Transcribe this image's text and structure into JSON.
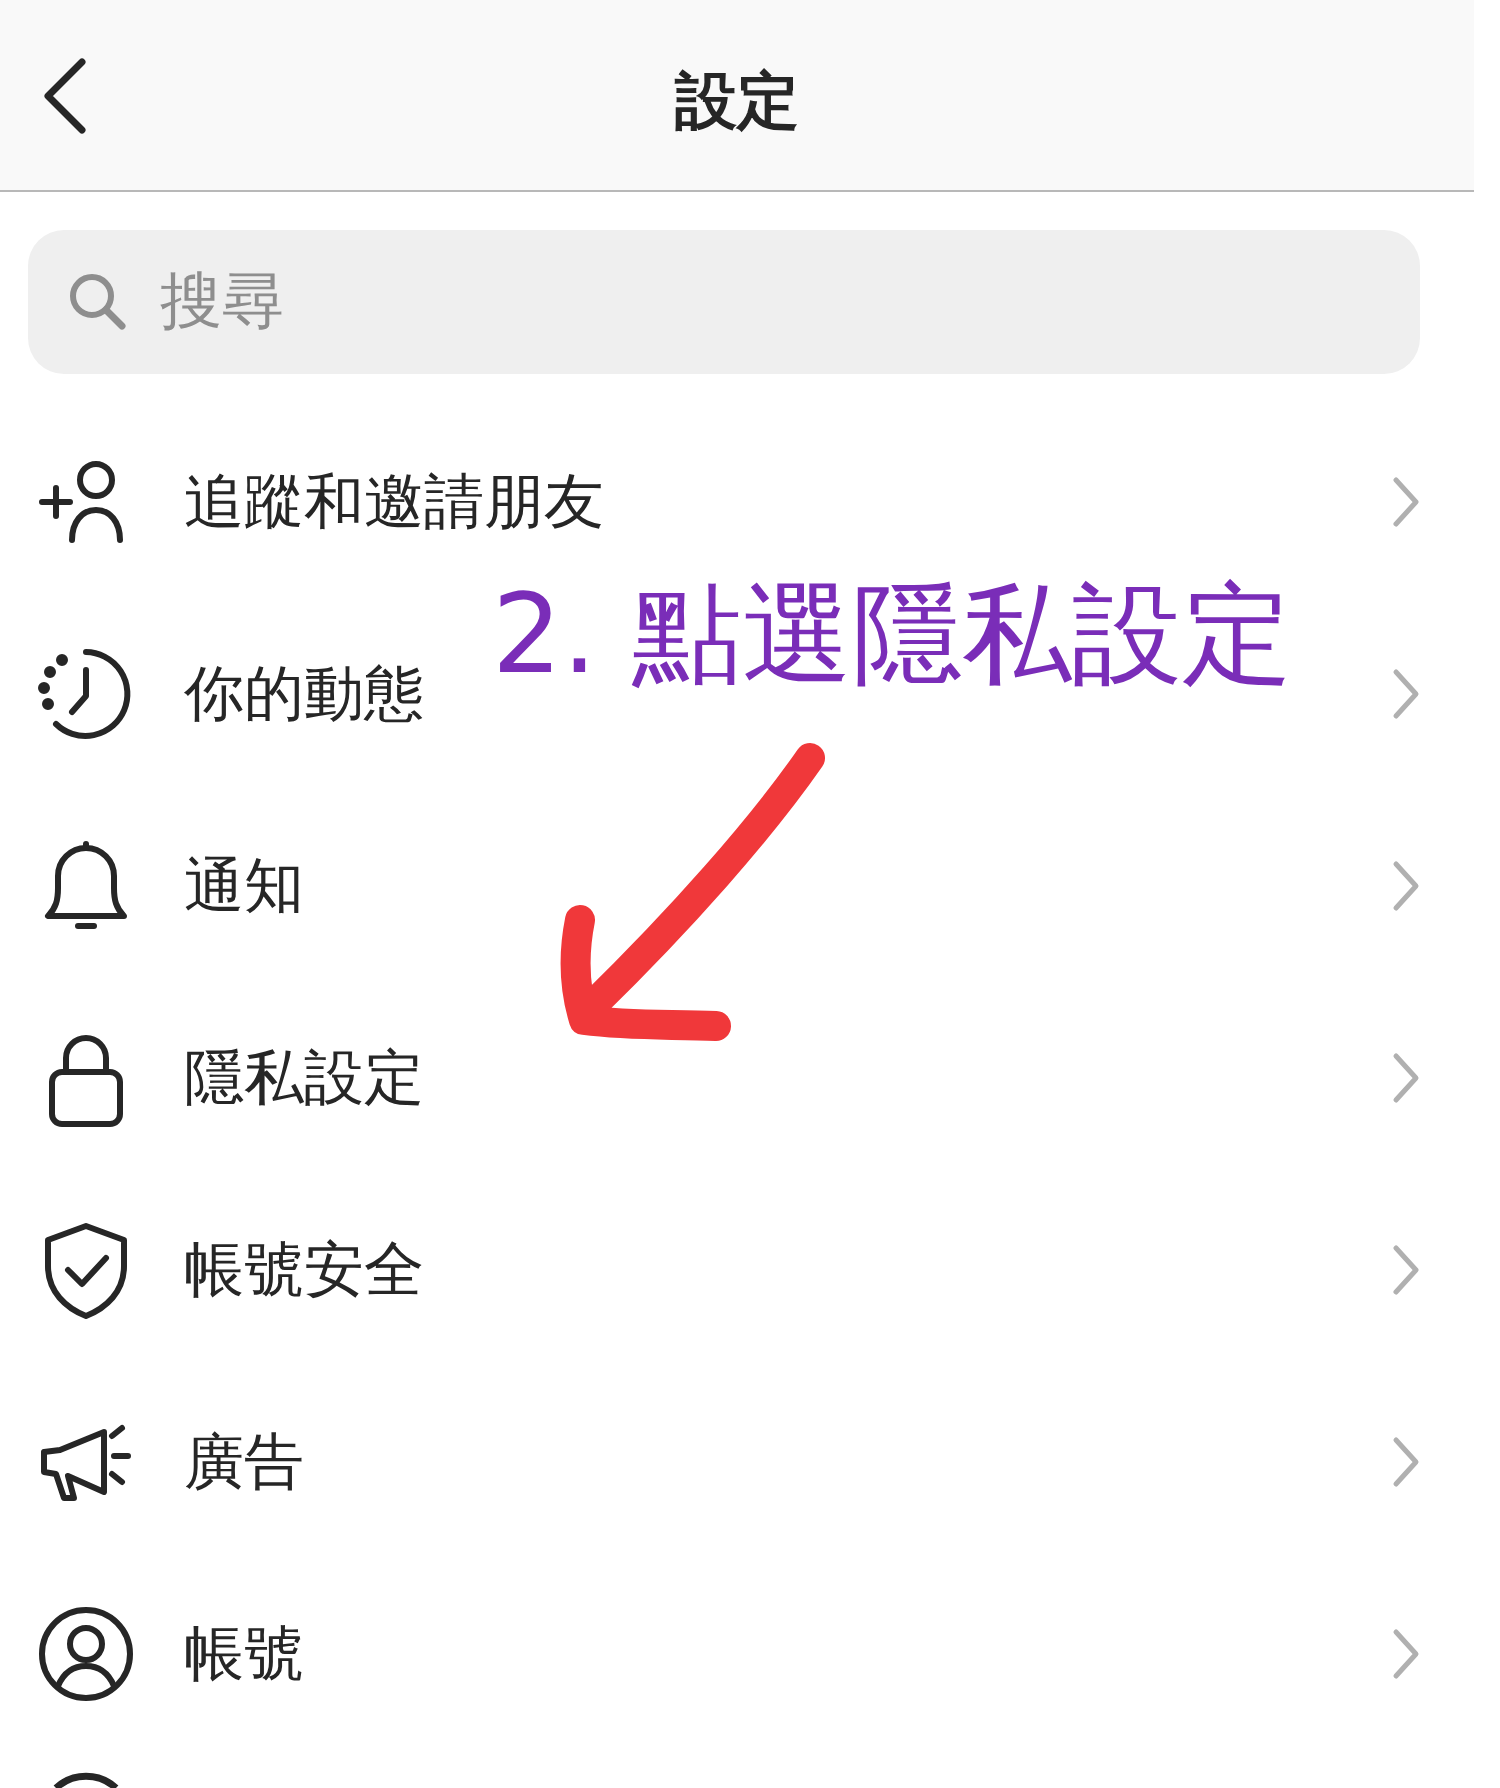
{
  "header": {
    "title": "設定"
  },
  "search": {
    "placeholder": "搜尋"
  },
  "items": [
    {
      "label": "追蹤和邀請朋友"
    },
    {
      "label": "你的動態"
    },
    {
      "label": "通知"
    },
    {
      "label": "隱私設定"
    },
    {
      "label": "帳號安全"
    },
    {
      "label": "廣告"
    },
    {
      "label": "帳號"
    }
  ],
  "annotation": {
    "text": "2. 點選隱私設定"
  }
}
